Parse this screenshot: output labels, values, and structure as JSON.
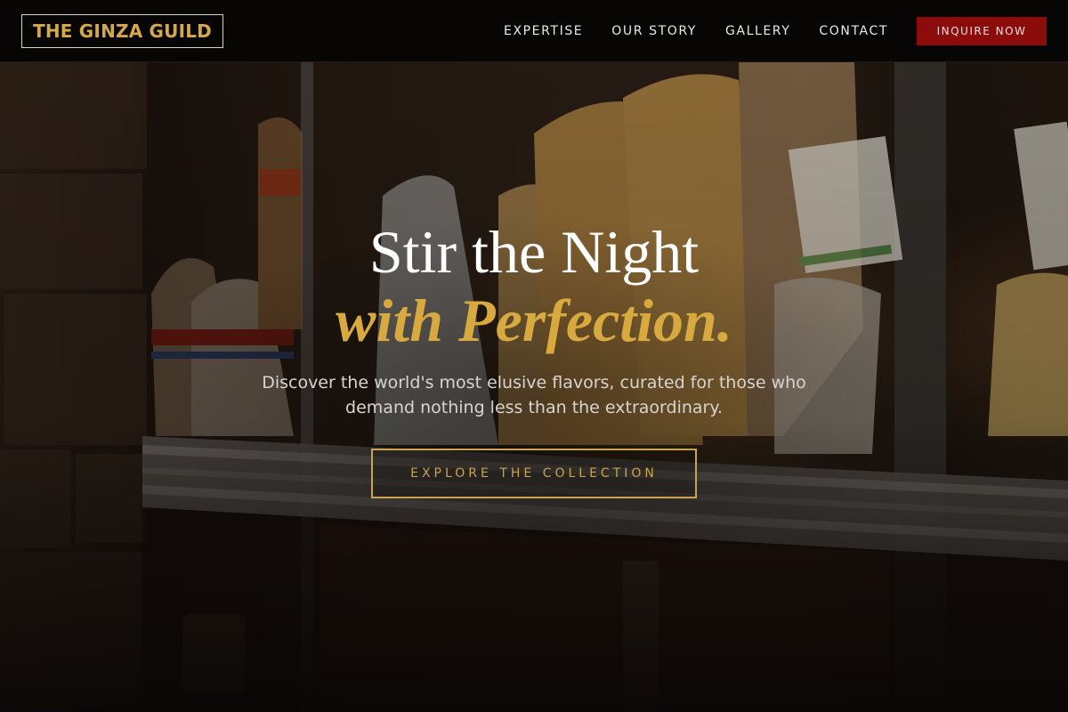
{
  "brand": {
    "logo_text": "THE GINZA GUILD"
  },
  "nav": {
    "links": [
      {
        "label": "EXPERTISE"
      },
      {
        "label": "OUR STORY"
      },
      {
        "label": "GALLERY"
      },
      {
        "label": "CONTACT"
      }
    ],
    "cta_label": "INQUIRE NOW"
  },
  "hero": {
    "headline_line1": "Stir the Night",
    "headline_line2": "with Perfection.",
    "subtitle": "Discover the world's most elusive flavors, curated for those who demand nothing less than the extraordinary.",
    "cta_label": "EXPLORE THE COLLECTION"
  },
  "colors": {
    "accent_gold": "#d8a93f",
    "cta_red": "#8c0b0b",
    "nav_background": "#070605"
  }
}
